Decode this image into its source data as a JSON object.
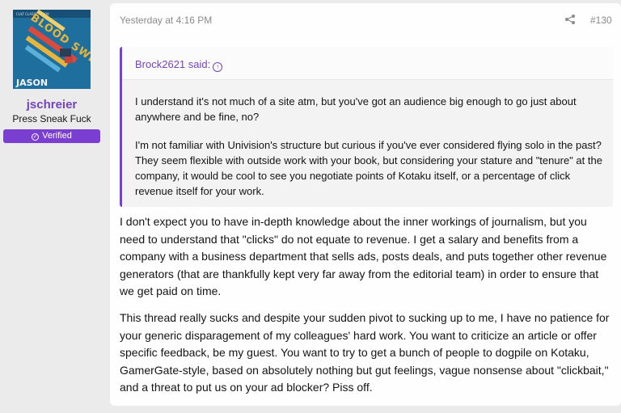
{
  "user": {
    "avatar_top_text": "CULT CLASSIC BOOK",
    "avatar_title": "BLOOD SWEAT AND PIXELS",
    "avatar_author": "JASON",
    "username": "jschreier",
    "title": "Press Sneak Fuck",
    "badge": "Verified"
  },
  "post": {
    "date": "Yesterday at 4:16 PM",
    "share_icon": "share-icon",
    "number": "#130",
    "quote": {
      "author": "Brock2621 said:",
      "up_icon": "arrow-up-circle-icon",
      "paragraphs": [
        "I understand it's not much of a site atm, but you've got an audience big enough to go just about anywhere and be fine, no?",
        "I'm not familiar with Univision's structure but curious if you've ever considered flying solo in the past? They seem flexible with outside work with your book, but considering your stature and \"tenure\" at the company, it would be cool to see you negotiate points of Kotaku itself, or a percentage of click revenue itself for your work."
      ]
    },
    "paragraphs": [
      "I don't expect you to have in-depth knowledge about the inner workings of journalism, but you need to understand that \"clicks\" do not equate to revenue. I get a salary and benefits from a company with a business department that sells ads, posts deals, and puts together other revenue generators (that are thankfully kept very far away from the editorial team) in order to ensure that we get paid on time.",
      "This thread really sucks and despite your sudden pivot to sucking up to me, I have no patience for your generic disparagement of my colleagues' hard work. You want to criticize an article or offer specific feedback, be my guest. You want to try to get a bunch of people to dogpile on Kotaku, GamerGate-style, based on absolutely nothing but gut feelings, vague nonsense about \"clickbait,\" and a threat to put us on your ad blocker? Piss off."
    ]
  },
  "colors": {
    "accent": "#7445b8",
    "badge": "#7a3fd0",
    "page_bg": "#ebebeb",
    "post_bg": "#fefefe",
    "avatar_bg": "#1e6f9e",
    "avatar_letters": "#e8b43a"
  }
}
